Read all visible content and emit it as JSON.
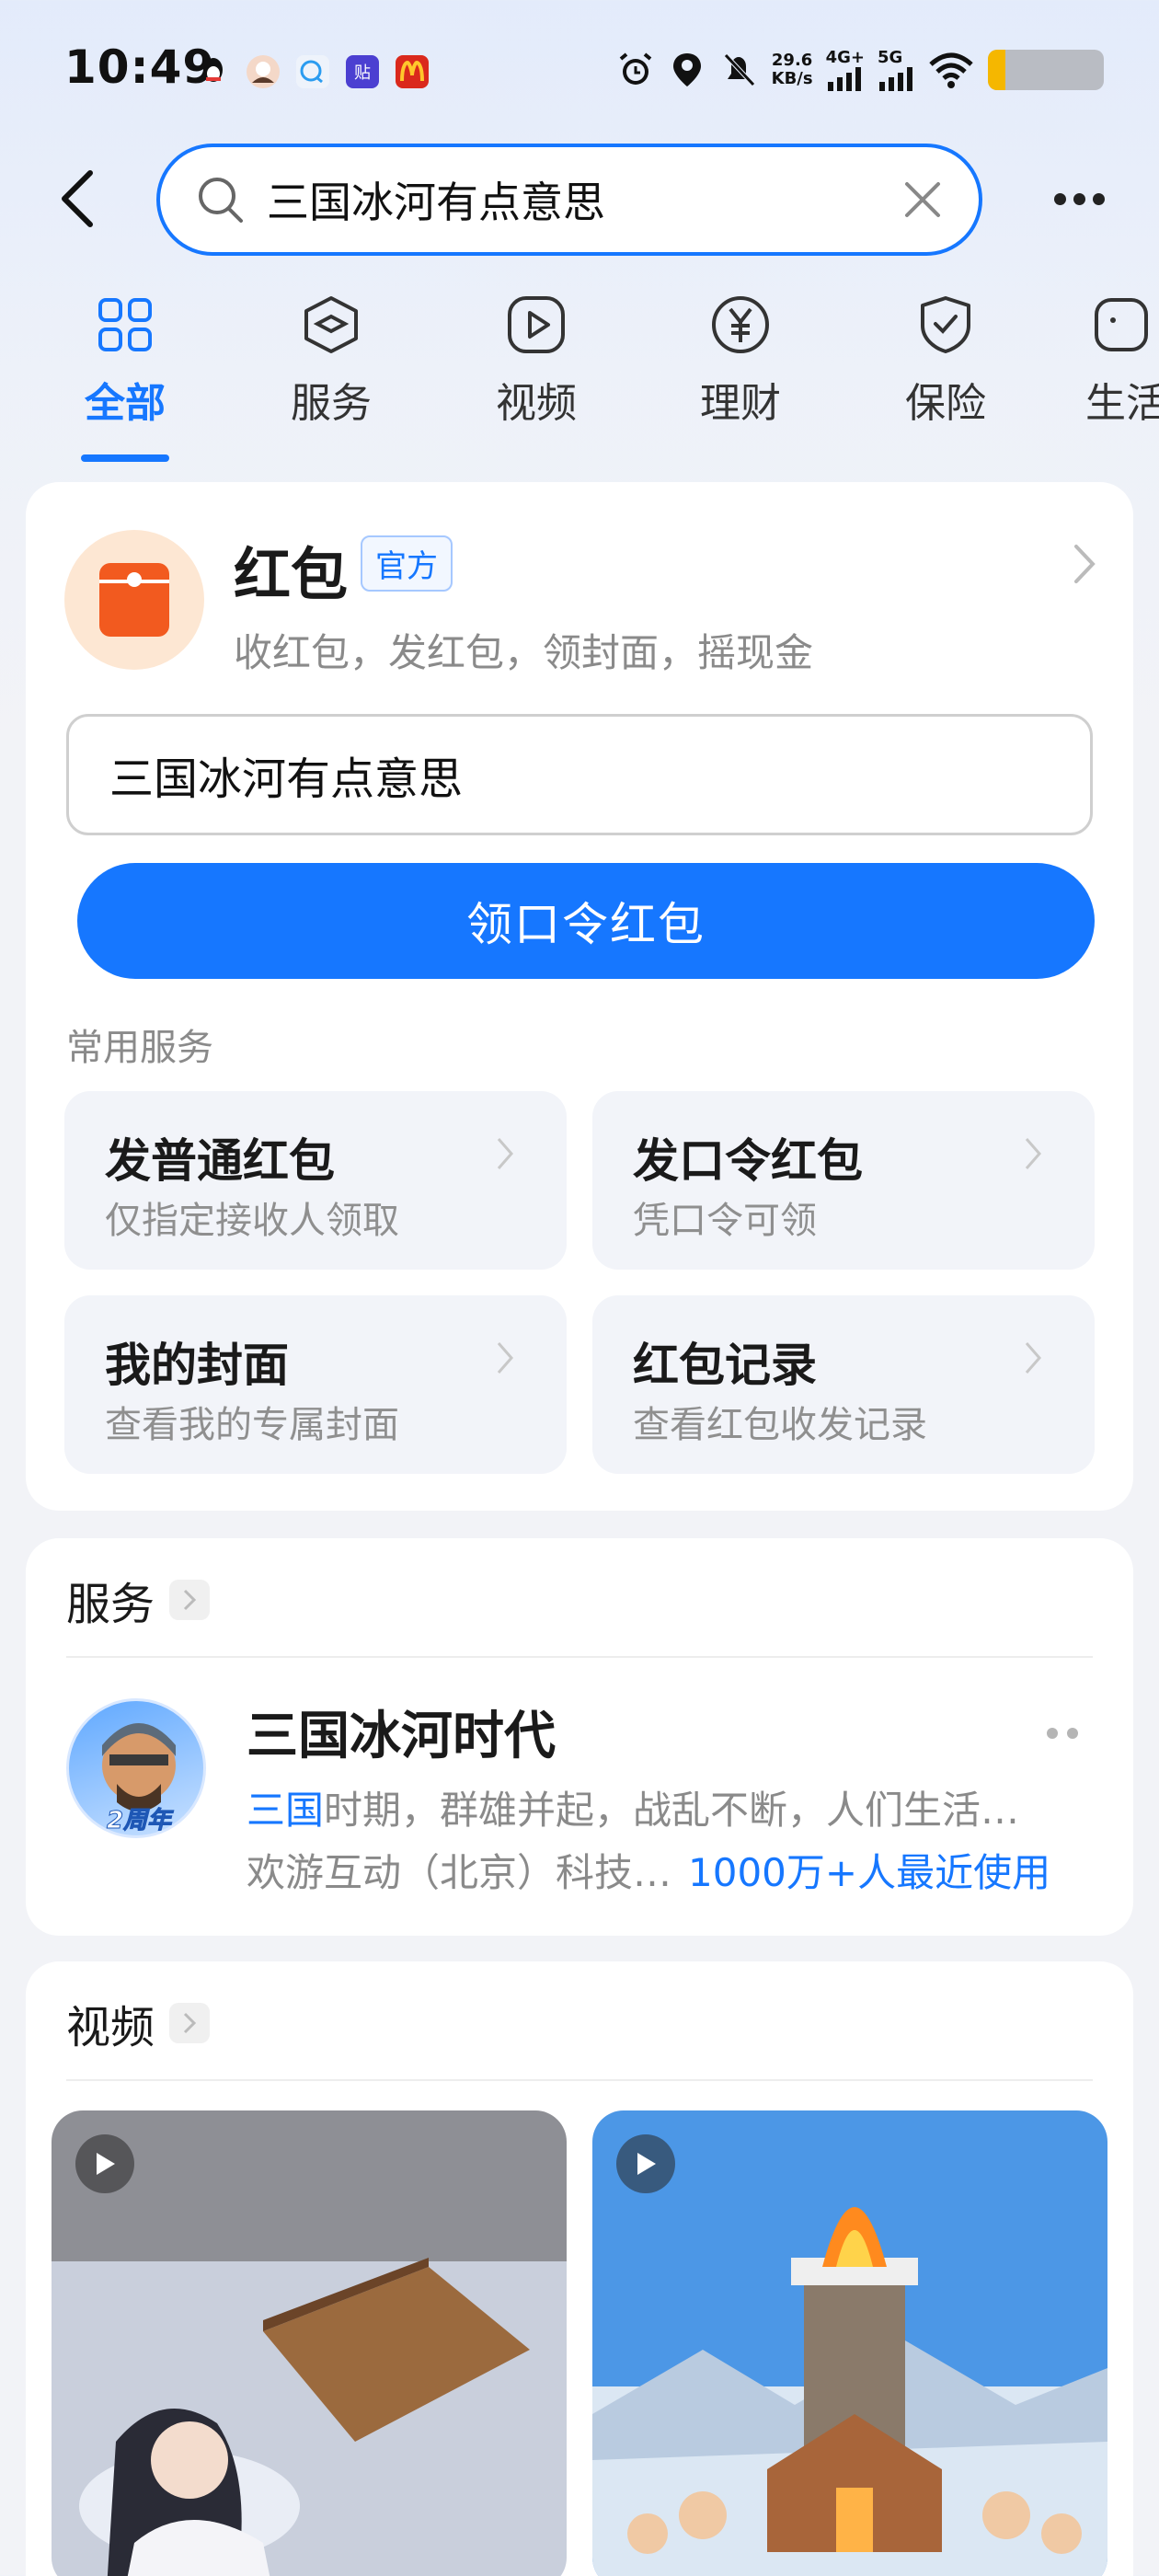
{
  "status_bar": {
    "time": "10:49",
    "net_speed_value": "29.6",
    "net_speed_unit": "KB/s",
    "net_4g": "4G+",
    "net_5g": "5G",
    "notification_icons": [
      "qq-icon",
      "avatar-icon",
      "chat-bubble-icon",
      "tieba-icon",
      "mcdonalds-icon"
    ],
    "system_icons": [
      "alarm-icon",
      "location-icon",
      "mute-icon",
      "signal-icon",
      "wifi-icon",
      "battery-icon"
    ],
    "battery_level": 0.15
  },
  "search": {
    "query": "三国冰河有点意思"
  },
  "tabs": [
    {
      "label": "全部",
      "icon": "grid-icon",
      "active": true
    },
    {
      "label": "服务",
      "icon": "cube-icon",
      "active": false
    },
    {
      "label": "视频",
      "icon": "play-icon",
      "active": false
    },
    {
      "label": "理财",
      "icon": "yen-icon",
      "active": false
    },
    {
      "label": "保险",
      "icon": "shield-icon",
      "active": false
    },
    {
      "label": "生活",
      "icon": "face-icon",
      "active": false
    }
  ],
  "red_packet": {
    "title": "红包",
    "badge": "官方",
    "description": "收红包，发红包，领封面，摇现金",
    "input_value": "三国冰河有点意思",
    "claim_button": "领口令红包",
    "common_services_label": "常用服务",
    "services": [
      {
        "title": "发普通红包",
        "subtitle": "仅指定接收人领取"
      },
      {
        "title": "发口令红包",
        "subtitle": "凭口令可领"
      },
      {
        "title": "我的封面",
        "subtitle": "查看我的专属封面"
      },
      {
        "title": "红包记录",
        "subtitle": "查看红包收发记录"
      }
    ]
  },
  "service_section": {
    "header": "服务",
    "app": {
      "name": "三国冰河时代",
      "badge_text": "2周年",
      "desc_highlight": "三国",
      "desc_rest": "时期，群雄并起，战乱不断，人们生活…",
      "developer": "欢游互动（北京）科技…",
      "users": "1000万+人最近使用"
    }
  },
  "video_section": {
    "header": "视频"
  },
  "colors": {
    "accent": "#1677ff",
    "red_packet": "#f25a1f"
  }
}
